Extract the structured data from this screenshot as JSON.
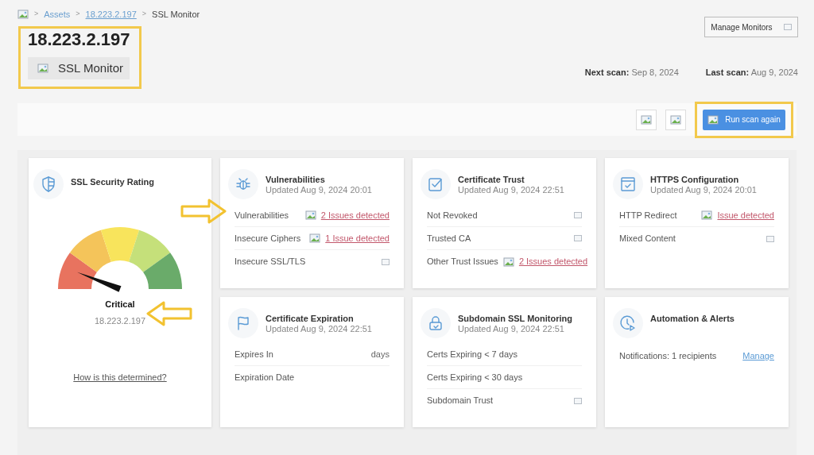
{
  "breadcrumb": [
    {
      "text": ">",
      "kind": "separator"
    },
    {
      "text": "Assets",
      "kind": "link"
    },
    {
      "text": ">",
      "kind": "separator"
    },
    {
      "text": "18.223.2.197",
      "kind": "underlined"
    },
    {
      "text": ">",
      "kind": "separator"
    },
    {
      "text": "SSL Monitor",
      "kind": "current"
    }
  ],
  "header": {
    "title": "18.223.2.197",
    "badge": "SSL Monitor",
    "manage_button": "Manage Monitors",
    "next_scan": {
      "label": "Next scan:",
      "value": "Sep 8, 2024"
    },
    "last_scan": {
      "label": "Last scan:",
      "value": "Aug 9, 2024"
    }
  },
  "toolbar": {
    "run_button": "Run scan again"
  },
  "rating": {
    "title": "SSL Security Rating",
    "grade": "Critical",
    "host": "18.223.2.197",
    "link": "How is this determined?"
  },
  "cards": [
    {
      "kind": "bug",
      "title": "Vulnerabilities",
      "updated": "Updated Aug 9, 2024 20:01",
      "rows": [
        {
          "label": "Vulnerabilities",
          "kind": "issue",
          "value": "2 Issues detected"
        },
        {
          "label": "Insecure Ciphers",
          "kind": "issue",
          "value": "1 Issue detected"
        },
        {
          "label": "Insecure SSL/TLS",
          "kind": "ok"
        }
      ]
    },
    {
      "kind": "check",
      "title": "Certificate Trust",
      "updated": "Updated Aug 9, 2024 22:51",
      "rows": [
        {
          "label": "Not Revoked",
          "kind": "ok"
        },
        {
          "label": "Trusted CA",
          "kind": "ok"
        },
        {
          "label": "Other Trust Issues",
          "kind": "issue",
          "value": "2 Issues detected"
        }
      ]
    },
    {
      "kind": "browser",
      "title": "HTTPS Configuration",
      "updated": "Updated Aug 9, 2024 20:01",
      "rows": [
        {
          "label": "HTTP Redirect",
          "kind": "issue",
          "value": "Issue detected"
        },
        {
          "label": "Mixed Content",
          "kind": "ok"
        }
      ]
    },
    {
      "kind": "flag",
      "title": "Certificate Expiration",
      "updated": "Updated Aug 9, 2024 22:51",
      "rows": [
        {
          "label": "Expires In",
          "kind": "text",
          "value": "days"
        },
        {
          "label": "Expiration Date",
          "kind": "none"
        }
      ]
    },
    {
      "kind": "lock",
      "title": "Subdomain SSL Monitoring",
      "updated": "Updated Aug 9, 2024 22:51",
      "rows": [
        {
          "label": "Certs Expiring < 7 days",
          "kind": "none"
        },
        {
          "label": "Certs Expiring < 30 days",
          "kind": "none"
        },
        {
          "label": "Subdomain Trust",
          "kind": "ok"
        }
      ]
    },
    {
      "kind": "clock",
      "title": "Automation & Alerts",
      "rows": [
        {
          "label": "Notifications: 1 recipients",
          "kind": "link",
          "value": "Manage"
        }
      ]
    }
  ]
}
